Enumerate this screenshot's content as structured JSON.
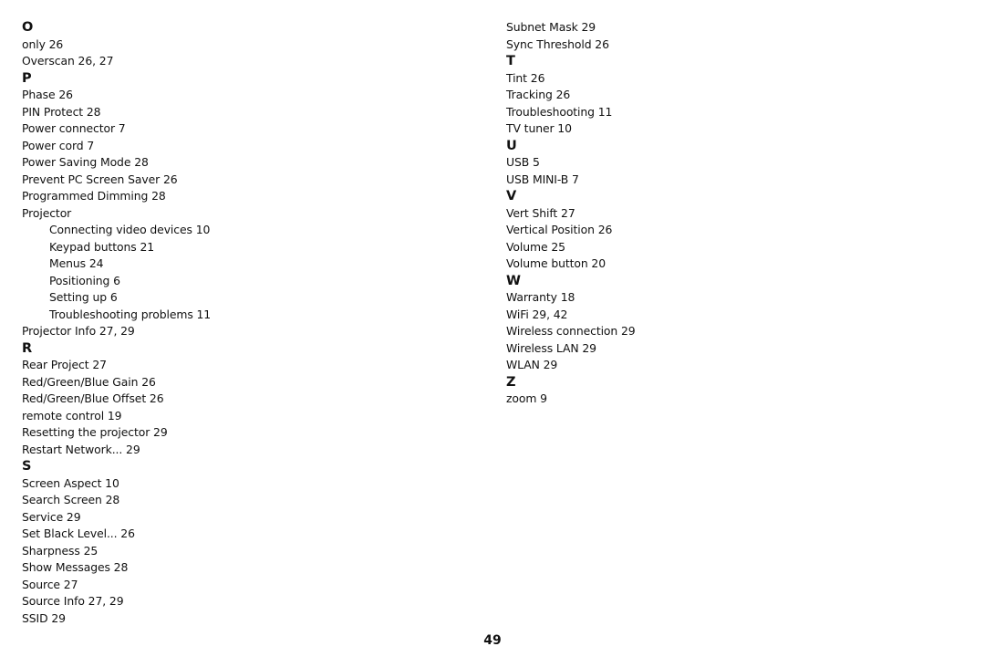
{
  "page_number": "49",
  "left_column": [
    {
      "type": "heading",
      "text": "O"
    },
    {
      "type": "entry",
      "text": "only 26"
    },
    {
      "type": "entry",
      "text": "Overscan 26, 27"
    },
    {
      "type": "heading",
      "text": "P"
    },
    {
      "type": "entry",
      "text": "Phase 26"
    },
    {
      "type": "entry",
      "text": "PIN Protect 28"
    },
    {
      "type": "entry",
      "text": "Power connector 7"
    },
    {
      "type": "entry",
      "text": "Power cord 7"
    },
    {
      "type": "entry",
      "text": "Power Saving Mode 28"
    },
    {
      "type": "entry",
      "text": "Prevent PC Screen Saver 26"
    },
    {
      "type": "entry",
      "text": "Programmed Dimming 28"
    },
    {
      "type": "entry",
      "text": "Projector"
    },
    {
      "type": "sub",
      "text": "Connecting video devices 10"
    },
    {
      "type": "sub",
      "text": "Keypad buttons 21"
    },
    {
      "type": "sub",
      "text": "Menus 24"
    },
    {
      "type": "sub",
      "text": "Positioning 6"
    },
    {
      "type": "sub",
      "text": "Setting up 6"
    },
    {
      "type": "sub",
      "text": "Troubleshooting problems 11"
    },
    {
      "type": "entry",
      "text": "Projector Info 27, 29"
    },
    {
      "type": "heading",
      "text": "R"
    },
    {
      "type": "entry",
      "text": "Rear Project 27"
    },
    {
      "type": "entry",
      "text": "Red/Green/Blue Gain 26"
    },
    {
      "type": "entry",
      "text": "Red/Green/Blue Offset 26"
    },
    {
      "type": "entry",
      "text": "remote control 19"
    },
    {
      "type": "entry",
      "text": "Resetting the projector 29"
    },
    {
      "type": "entry",
      "text": "Restart Network... 29"
    },
    {
      "type": "heading",
      "text": "S"
    },
    {
      "type": "entry",
      "text": "Screen Aspect 10"
    },
    {
      "type": "entry",
      "text": "Search Screen 28"
    },
    {
      "type": "entry",
      "text": "Service 29"
    },
    {
      "type": "entry",
      "text": "Set Black Level... 26"
    },
    {
      "type": "entry",
      "text": "Sharpness 25"
    },
    {
      "type": "entry",
      "text": "Show Messages 28"
    },
    {
      "type": "entry",
      "text": "Source 27"
    },
    {
      "type": "entry",
      "text": "Source Info 27, 29"
    },
    {
      "type": "entry",
      "text": "SSID 29"
    }
  ],
  "right_column": [
    {
      "type": "entry",
      "text": "Subnet Mask 29"
    },
    {
      "type": "entry",
      "text": "Sync Threshold 26"
    },
    {
      "type": "heading",
      "text": "T"
    },
    {
      "type": "entry",
      "text": "Tint 26"
    },
    {
      "type": "entry",
      "text": "Tracking 26"
    },
    {
      "type": "entry",
      "text": "Troubleshooting 11"
    },
    {
      "type": "entry",
      "text": "TV tuner 10"
    },
    {
      "type": "heading",
      "text": "U"
    },
    {
      "type": "entry",
      "text": "USB 5"
    },
    {
      "type": "entry",
      "text": "USB MINI-B 7"
    },
    {
      "type": "heading",
      "text": "V"
    },
    {
      "type": "entry",
      "text": "Vert Shift 27"
    },
    {
      "type": "entry",
      "text": "Vertical Position 26"
    },
    {
      "type": "entry",
      "text": "Volume 25"
    },
    {
      "type": "entry",
      "text": "Volume button 20"
    },
    {
      "type": "heading",
      "text": "W"
    },
    {
      "type": "entry",
      "text": "Warranty 18"
    },
    {
      "type": "entry",
      "text": "WiFi 29, 42"
    },
    {
      "type": "entry",
      "text": "Wireless connection 29"
    },
    {
      "type": "entry",
      "text": "Wireless LAN 29"
    },
    {
      "type": "entry",
      "text": "WLAN 29"
    },
    {
      "type": "heading",
      "text": "Z"
    },
    {
      "type": "entry",
      "text": "zoom 9"
    }
  ]
}
